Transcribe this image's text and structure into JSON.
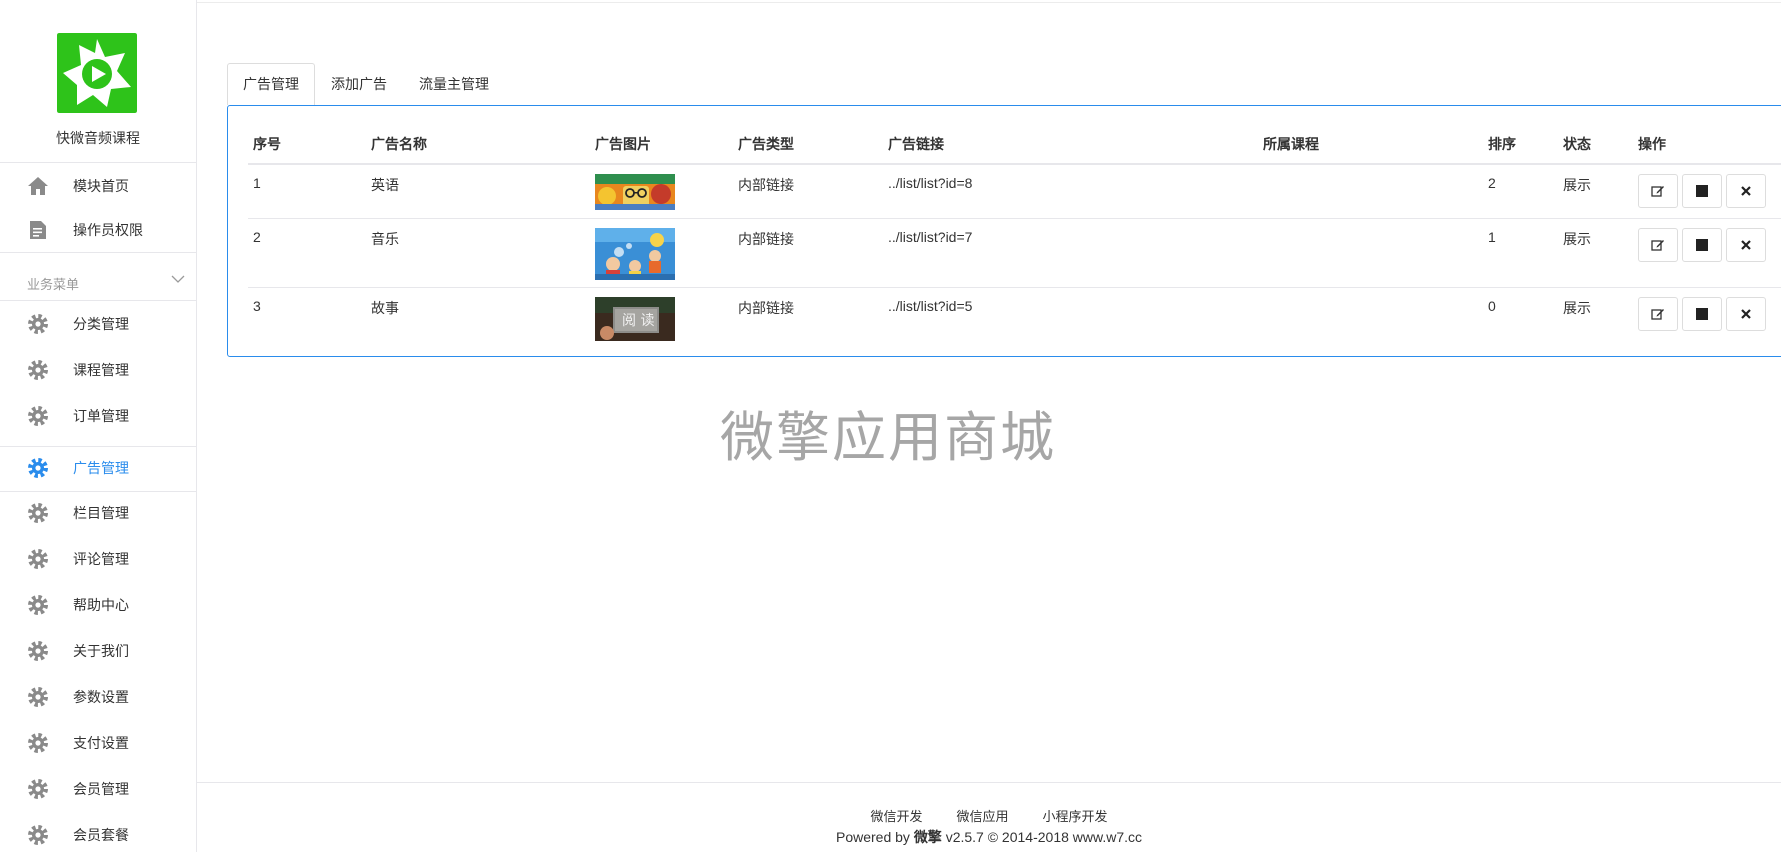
{
  "brand": {
    "name": "快微音频课程",
    "logo_color": "#2ec31a"
  },
  "sidebar": {
    "top_items": [
      {
        "label": "模块首页",
        "icon": "home-icon"
      },
      {
        "label": "操作员权限",
        "icon": "document-icon"
      }
    ],
    "section_title": "业务菜单",
    "items": [
      {
        "label": "分类管理",
        "icon": "gear-icon"
      },
      {
        "label": "课程管理",
        "icon": "gear-icon"
      },
      {
        "label": "订单管理",
        "icon": "gear-icon"
      },
      {
        "label": "广告管理",
        "icon": "gear-icon",
        "active": true
      },
      {
        "label": "栏目管理",
        "icon": "gear-icon"
      },
      {
        "label": "评论管理",
        "icon": "gear-icon"
      },
      {
        "label": "帮助中心",
        "icon": "gear-icon"
      },
      {
        "label": "关于我们",
        "icon": "gear-icon"
      },
      {
        "label": "参数设置",
        "icon": "gear-icon"
      },
      {
        "label": "支付设置",
        "icon": "gear-icon"
      },
      {
        "label": "会员管理",
        "icon": "gear-icon"
      },
      {
        "label": "会员套餐",
        "icon": "gear-icon"
      }
    ],
    "accent_color": "#2a8cec"
  },
  "tabs": [
    {
      "label": "广告管理",
      "active": true
    },
    {
      "label": "添加广告"
    },
    {
      "label": "流量主管理"
    }
  ],
  "table": {
    "headers": [
      "序号",
      "广告名称",
      "广告图片",
      "广告类型",
      "广告链接",
      "所属课程",
      "排序",
      "状态",
      "操作"
    ],
    "rows": [
      {
        "id": "1",
        "name": "英语",
        "type": "内部链接",
        "link": "../list/list?id=8",
        "course": "",
        "sort": "2",
        "status": "展示"
      },
      {
        "id": "2",
        "name": "音乐",
        "type": "内部链接",
        "link": "../list/list?id=7",
        "course": "",
        "sort": "1",
        "status": "展示"
      },
      {
        "id": "3",
        "name": "故事",
        "type": "内部链接",
        "link": "../list/list?id=5",
        "course": "",
        "sort": "0",
        "status": "展示"
      }
    ]
  },
  "thumbnails": {
    "row3_overlay_text": "阅 读"
  },
  "watermark": "微擎应用商城",
  "footer": {
    "links": [
      "微信开发",
      "微信应用",
      "小程序开发"
    ],
    "copy_prefix": "Powered by ",
    "copy_brand": "微擎",
    "copy_suffix": " v2.5.7 © 2014-2018 www.w7.cc"
  }
}
